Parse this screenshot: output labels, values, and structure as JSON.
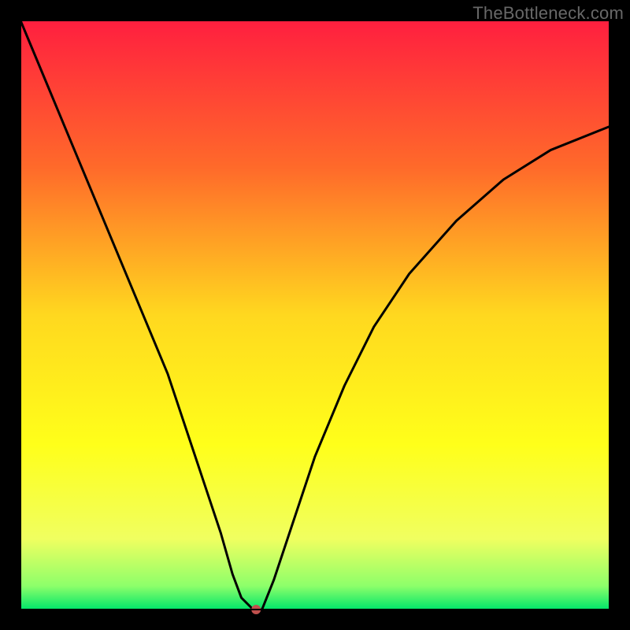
{
  "watermark": "TheBottleneck.com",
  "chart_data": {
    "type": "line",
    "title": "",
    "xlabel": "",
    "ylabel": "",
    "xlim": [
      0,
      100
    ],
    "ylim": [
      0,
      100
    ],
    "gradient_stops": [
      {
        "offset": 0.0,
        "color": "#ff1f3f"
      },
      {
        "offset": 0.25,
        "color": "#ff6a2a"
      },
      {
        "offset": 0.5,
        "color": "#ffd81f"
      },
      {
        "offset": 0.72,
        "color": "#ffff1a"
      },
      {
        "offset": 0.88,
        "color": "#f0ff60"
      },
      {
        "offset": 0.96,
        "color": "#8dff6a"
      },
      {
        "offset": 1.0,
        "color": "#00e56a"
      }
    ],
    "series": [
      {
        "name": "bottleneck-curve",
        "x": [
          0,
          5,
          10,
          15,
          20,
          25,
          28,
          31,
          34,
          36,
          37.5,
          39.5,
          41,
          43,
          46,
          50,
          55,
          60,
          66,
          74,
          82,
          90,
          100
        ],
        "y": [
          100,
          88,
          76,
          64,
          52,
          40,
          31,
          22,
          13,
          6,
          2,
          0,
          0,
          5,
          14,
          26,
          38,
          48,
          57,
          66,
          73,
          78,
          82
        ]
      }
    ],
    "marker": {
      "x": 40,
      "y": 0,
      "color": "#c0504d",
      "r": 6
    }
  },
  "frame": {
    "outer_border_px": 26,
    "inner_border_px": 2,
    "border_color": "#000000"
  }
}
